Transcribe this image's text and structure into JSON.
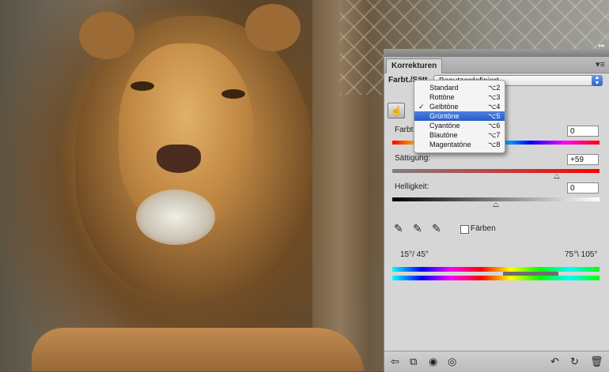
{
  "panel": {
    "tab_label": "Korrekturen",
    "collapse_glyph": "▸▸",
    "menu_glyph": "▾≡",
    "preset_label": "Farbt./Sätt.",
    "preset_value": "Benutzerdefiniert",
    "hand_glyph": "☝",
    "hue": {
      "label": "Farbton:",
      "value": "0",
      "level": 0.5
    },
    "saturation": {
      "label": "Sättigung:",
      "value": "+59",
      "level": 0.795
    },
    "lightness": {
      "label": "Helligkeit:",
      "value": "0",
      "level": 0.5
    },
    "colorize_label": "Färben",
    "range_left": "15°/ 45°",
    "range_right": "75°\\ 105°"
  },
  "menu": {
    "items": [
      {
        "label": "Standard",
        "shortcut": "⌥2",
        "checked": false,
        "selected": false
      },
      {
        "label": "Rottöne",
        "shortcut": "⌥3",
        "checked": false,
        "selected": false
      },
      {
        "label": "Gelbtöne",
        "shortcut": "⌥4",
        "checked": true,
        "selected": false
      },
      {
        "label": "Grüntöne",
        "shortcut": "⌥5",
        "checked": false,
        "selected": true
      },
      {
        "label": "Cyantöne",
        "shortcut": "⌥6",
        "checked": false,
        "selected": false
      },
      {
        "label": "Blautöne",
        "shortcut": "⌥7",
        "checked": false,
        "selected": false
      },
      {
        "label": "Magentatöne",
        "shortcut": "⌥8",
        "checked": false,
        "selected": false
      }
    ],
    "check_glyph": "✓"
  },
  "icons": {
    "eyedropper": "✎",
    "eyedropper_plus": "✎",
    "eyedropper_minus": "✎",
    "back": "⇦",
    "expand": "⧉",
    "clip": "◉",
    "visibility": "◎",
    "prev_state": "↶",
    "reset": "↻",
    "trash": "🗑"
  },
  "colors": {
    "accent": "#2a5cc9",
    "panel": "#d6d6d6"
  }
}
